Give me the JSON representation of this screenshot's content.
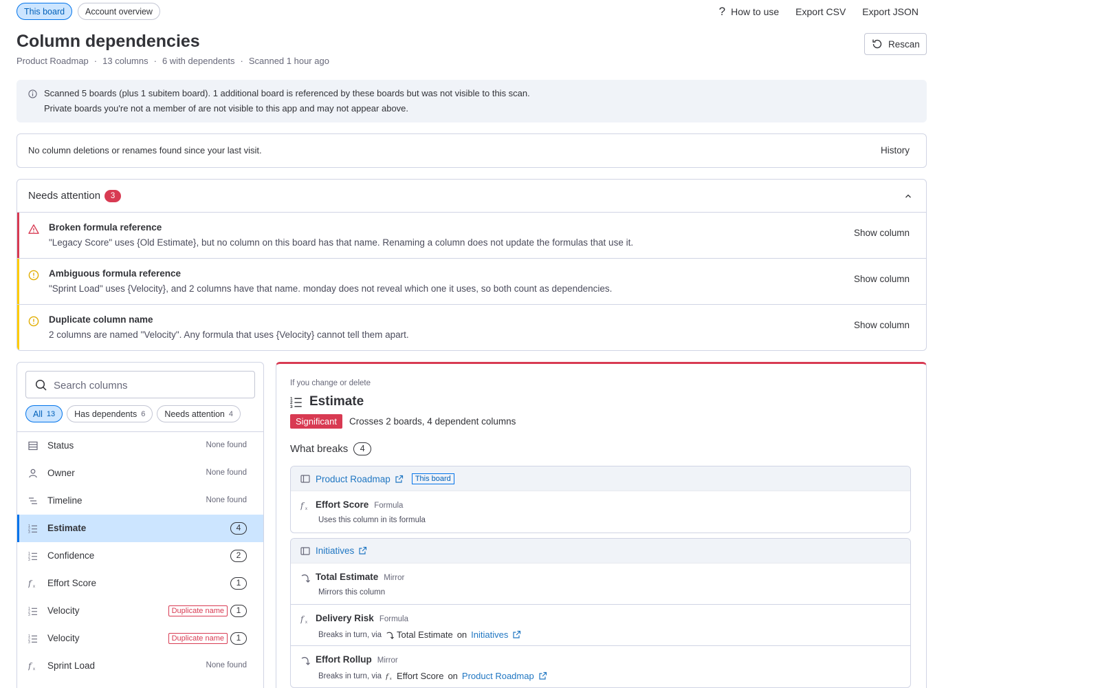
{
  "tabs": {
    "this_board": "This board",
    "account_overview": "Account overview"
  },
  "top_actions": {
    "how_to_use": "How to use",
    "export_csv": "Export CSV",
    "export_json": "Export JSON"
  },
  "header": {
    "title": "Column dependencies",
    "board_name": "Product Roadmap",
    "columns_count": "13 columns",
    "with_dependents": "6 with dependents",
    "scanned": "Scanned 1 hour ago",
    "sep": "·",
    "rescan": "Rescan"
  },
  "info": {
    "line1": "Scanned 5 boards (plus 1 subitem board). 1 additional board is referenced by these boards but was not visible to this scan.",
    "line2": "Private boards you're not a member of are not visible to this app and may not appear above."
  },
  "history_bar": {
    "text": "No column deletions or renames found since your last visit.",
    "history": "History"
  },
  "needs_attention": {
    "title": "Needs attention",
    "count": "3",
    "items": [
      {
        "severity": "error",
        "color": "#d83a52",
        "title": "Broken formula reference",
        "desc": "\"Legacy Score\" uses {Old Estimate}, but no column on this board has that name. Renaming a column does not update the formulas that use it.",
        "action": "Show column"
      },
      {
        "severity": "warning",
        "color": "#ffcb00",
        "title": "Ambiguous formula reference",
        "desc": "\"Sprint Load\" uses {Velocity}, and 2 columns have that name. monday does not reveal which one it uses, so both count as dependencies.",
        "action": "Show column"
      },
      {
        "severity": "warning",
        "color": "#ffcb00",
        "title": "Duplicate column name",
        "desc": "2 columns are named \"Velocity\". Any formula that uses {Velocity} cannot tell them apart.",
        "action": "Show column"
      }
    ]
  },
  "search": {
    "placeholder": "Search columns"
  },
  "filters": [
    {
      "label": "All",
      "count": "13",
      "active": true
    },
    {
      "label": "Has dependents",
      "count": "6",
      "active": false
    },
    {
      "label": "Needs attention",
      "count": "4",
      "active": false
    }
  ],
  "columns": [
    {
      "name": "Status",
      "icon": "status-icon",
      "none_found": "None found"
    },
    {
      "name": "Owner",
      "icon": "person-icon",
      "none_found": "None found"
    },
    {
      "name": "Timeline",
      "icon": "timeline-icon",
      "none_found": "None found"
    },
    {
      "name": "Estimate",
      "icon": "numbers-icon",
      "count": "4",
      "selected": true
    },
    {
      "name": "Confidence",
      "icon": "numbers-icon",
      "count": "2"
    },
    {
      "name": "Effort Score",
      "icon": "formula-icon",
      "count": "1"
    },
    {
      "name": "Velocity",
      "icon": "numbers-icon",
      "dup": "Duplicate name",
      "count": "1"
    },
    {
      "name": "Velocity",
      "icon": "numbers-icon",
      "dup": "Duplicate name",
      "count": "1"
    },
    {
      "name": "Sprint Load",
      "icon": "formula-icon",
      "none_found": "None found"
    }
  ],
  "detail": {
    "label": "If you change or delete",
    "title": "Estimate",
    "severity": "Significant",
    "severity_color": "#d83a52",
    "summary": "Crosses 2 boards, 4 dependent columns",
    "what_breaks": "What breaks",
    "what_breaks_count": "4",
    "boards": [
      {
        "name": "Product Roadmap",
        "tag": "This board",
        "rows": [
          {
            "name": "Effort Score",
            "type": "Formula",
            "icon": "formula-icon",
            "sub": "Uses this column in its formula"
          }
        ]
      },
      {
        "name": "Initiatives",
        "rows": [
          {
            "name": "Total Estimate",
            "type": "Mirror",
            "icon": "mirror-icon",
            "sub": "Mirrors this column"
          },
          {
            "name": "Delivery Risk",
            "type": "Formula",
            "icon": "formula-icon",
            "sub": "Breaks in turn, via",
            "via": "Total Estimate",
            "on": "on",
            "via_board": "Initiatives"
          },
          {
            "name": "Effort Rollup",
            "type": "Mirror",
            "icon": "mirror-icon",
            "sub": "Breaks in turn, via",
            "via": "Effort Score",
            "on": "on",
            "via_board": "Product Roadmap"
          }
        ]
      }
    ]
  }
}
